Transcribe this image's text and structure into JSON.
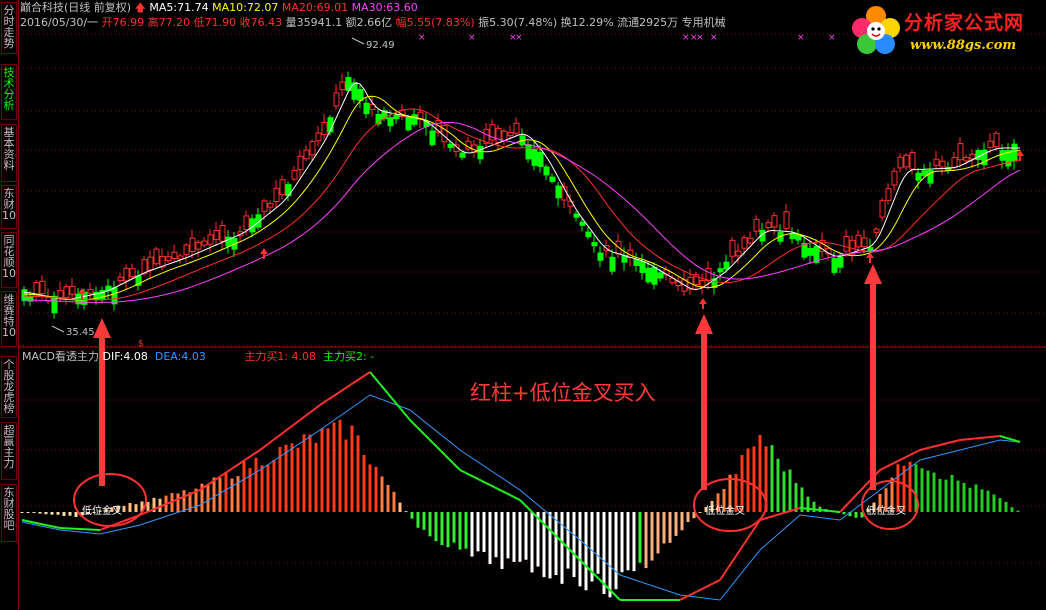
{
  "stock": {
    "name": "巅合科技",
    "period": "(日线 前复权)",
    "ma5_label": "MA5:",
    "ma5": "71.74",
    "ma10_label": "MA10:",
    "ma10": "72.07",
    "ma20_label": "MA20:",
    "ma20": "69.01",
    "ma30_label": "MA30:",
    "ma30": "63.60"
  },
  "quote": {
    "date": "2016/05/30/一",
    "open_label": "开",
    "open": "76.99",
    "high_label": "高",
    "high": "77.20",
    "low_label": "低",
    "low": "71.90",
    "close_label": "收",
    "close": "76.43",
    "vol_label": "量",
    "vol": "35941.1",
    "amount_label": "额",
    "amount": "2.66亿",
    "change_label": "幅",
    "change": "5.55(7.83%)",
    "swing_label": "振",
    "swing": "5.30(7.48%)",
    "turnover_label": "换",
    "turnover": "12.29%",
    "float_label": "流通",
    "float": "2925万",
    "sector": "专用机械"
  },
  "price_marks": {
    "high": "92.49",
    "low": "35.45"
  },
  "macd": {
    "title": "MACD看透主力",
    "dif_label": "DIF:",
    "dif": "4.08",
    "dea_label": "DEA:",
    "dea": "4.03",
    "buy1_label": "主力买1:",
    "buy1": "4.08",
    "buy2_label": "主力买2:",
    "buy2": "-"
  },
  "annotation": "红柱+低位金叉买入",
  "signal_label": "低位金叉",
  "sidebar": {
    "tabs": [
      {
        "label": "分时走势"
      },
      {
        "label": "技术分析"
      },
      {
        "label": "基本资料"
      },
      {
        "label": "东财10"
      },
      {
        "label": "同花顺10"
      },
      {
        "label": "维赛特10"
      },
      {
        "label": "个股龙虎榜"
      },
      {
        "label": "超赢主力"
      },
      {
        "label": "东财股吧"
      }
    ]
  },
  "logo": {
    "name": "分析家公式网",
    "url": "www.88gs.com"
  },
  "colors": {
    "up": "#ff3030",
    "down": "#00ff00",
    "ma5": "#ffffff",
    "ma10": "#ffff00",
    "ma20": "#ff3030",
    "ma30": "#ff40ff",
    "dif": "#ff3030",
    "dea": "#3399ff",
    "annotation": "#ff3a3a",
    "grid": "#8a0000"
  }
}
